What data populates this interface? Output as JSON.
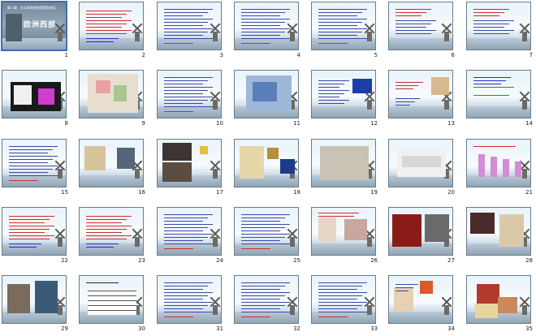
{
  "slides": [
    {
      "n": "1",
      "title": "欧洲西部",
      "header": "第八章　东半球其他的国家和地区",
      "kind": "cover"
    },
    {
      "n": "2",
      "title": "",
      "kind": "redtext"
    },
    {
      "n": "3",
      "title": "课前预习",
      "kind": "list"
    },
    {
      "n": "4",
      "title": "探究与提升",
      "kind": "dense"
    },
    {
      "n": "5",
      "title": "联想感悟与探索",
      "kind": "text"
    },
    {
      "n": "6",
      "title": "",
      "kind": "redlist"
    },
    {
      "n": "7",
      "title": "",
      "kind": "redlist2"
    },
    {
      "n": "8",
      "title": "欧洲西部的范围",
      "kind": "map"
    },
    {
      "n": "9",
      "title": "",
      "kind": "bigmap"
    },
    {
      "n": "10",
      "title": "",
      "kind": "dense2"
    },
    {
      "n": "11",
      "title": "",
      "kind": "bluemap"
    },
    {
      "n": "12",
      "title": "欧盟",
      "kind": "flag"
    },
    {
      "n": "13",
      "title": "",
      "kind": "person"
    },
    {
      "n": "14",
      "title": "欧盟成立的意义",
      "kind": "diagram"
    },
    {
      "n": "15",
      "title": "",
      "kind": "text2"
    },
    {
      "n": "16",
      "title": "",
      "kind": "products"
    },
    {
      "n": "17",
      "title": "",
      "kind": "photos"
    },
    {
      "n": "18",
      "title": "",
      "kind": "euro"
    },
    {
      "n": "19",
      "title": "",
      "kind": "house"
    },
    {
      "n": "20",
      "title": "",
      "kind": "ambulance"
    },
    {
      "n": "21",
      "title": "",
      "kind": "bars"
    },
    {
      "n": "22",
      "title": "",
      "kind": "text3"
    },
    {
      "n": "23",
      "title": "",
      "kind": "text4"
    },
    {
      "n": "24",
      "title": "",
      "kind": "text5"
    },
    {
      "n": "25",
      "title": "",
      "kind": "text6"
    },
    {
      "n": "26",
      "title": "",
      "kind": "flowers"
    },
    {
      "n": "27",
      "title": "",
      "kind": "cars"
    },
    {
      "n": "28",
      "title": "",
      "kind": "bags"
    },
    {
      "n": "29",
      "title": "",
      "kind": "people"
    },
    {
      "n": "30",
      "title": "",
      "kind": "table"
    },
    {
      "n": "31",
      "title": "",
      "kind": "text7"
    },
    {
      "n": "32",
      "title": "",
      "kind": "text8"
    },
    {
      "n": "33",
      "title": "",
      "kind": "text9"
    },
    {
      "n": "34",
      "title": "",
      "kind": "food"
    },
    {
      "n": "35",
      "title": "",
      "kind": "meat"
    }
  ],
  "selected": "1"
}
